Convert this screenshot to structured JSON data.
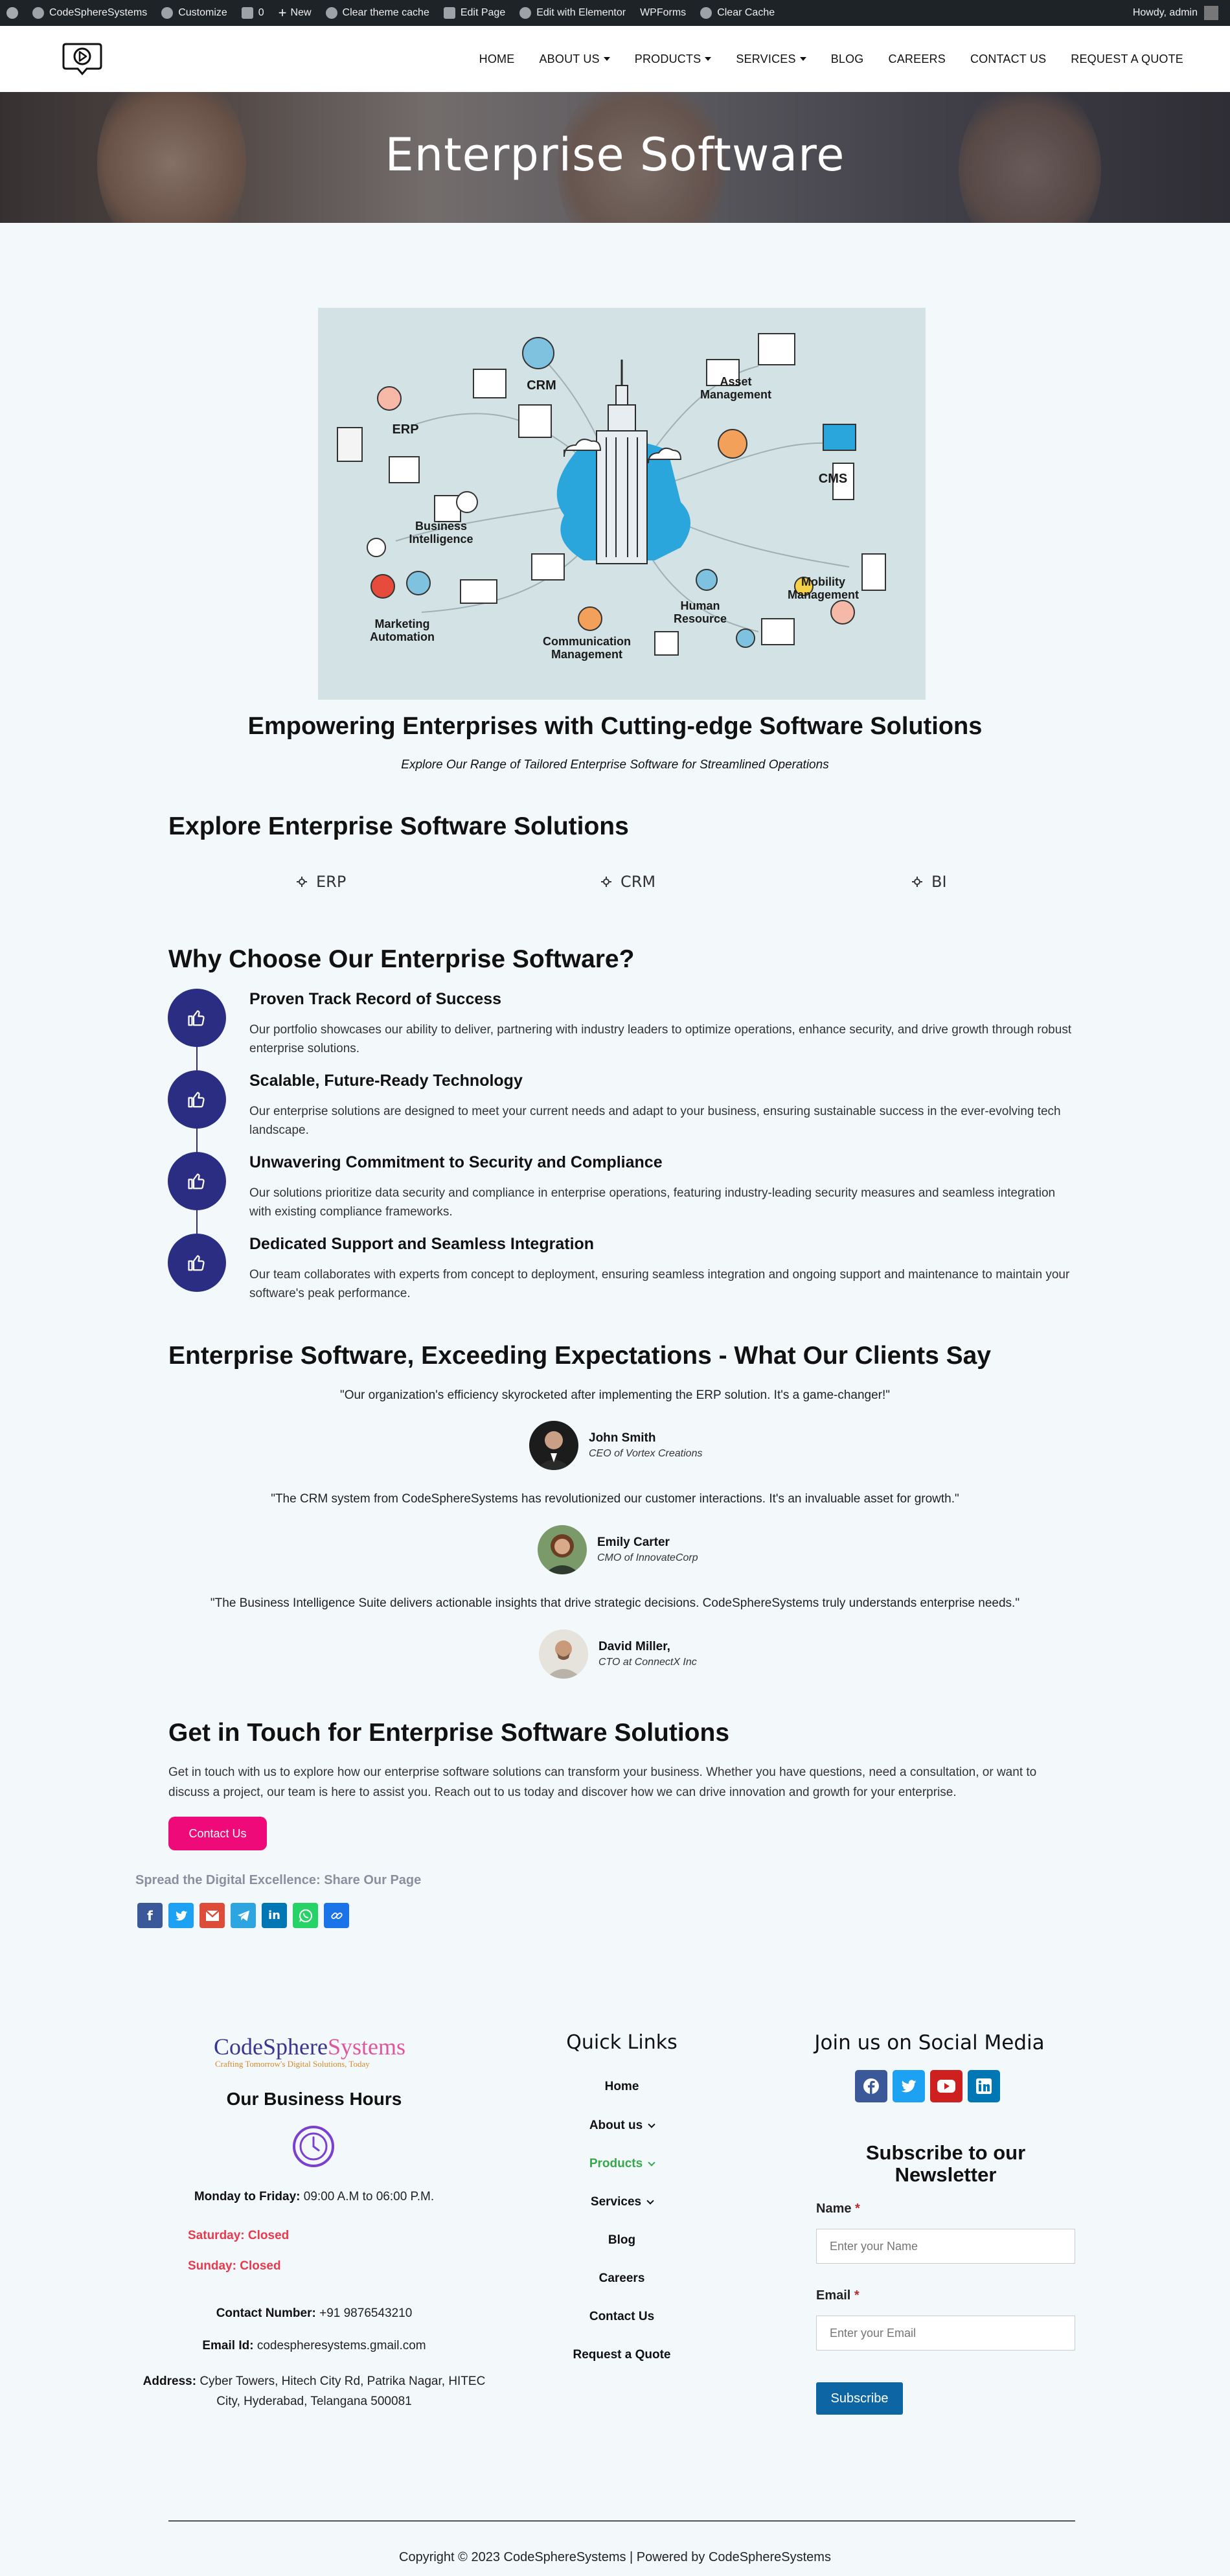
{
  "adminbar": {
    "site_name": "CodeSphereSystems",
    "customize": "Customize",
    "comments_count": "0",
    "new": "New",
    "clear_theme_cache": "Clear theme cache",
    "edit_page": "Edit Page",
    "edit_elementor": "Edit with Elementor",
    "wpforms": "WPForms",
    "clear_cache": "Clear Cache",
    "howdy": "Howdy, admin"
  },
  "nav": {
    "home": "HOME",
    "about": "ABOUT US",
    "products": "PRODUCTS",
    "services": "SERVICES",
    "blog": "BLOG",
    "careers": "CAREERS",
    "contact": "CONTACT US",
    "quote": "REQUEST A QUOTE"
  },
  "hero": {
    "title": "Enterprise Software"
  },
  "illustration": {
    "labels": {
      "crm": "CRM",
      "erp": "ERP",
      "asset": "Asset\nManagement",
      "cms": "CMS",
      "bi": "Business\nIntelligence",
      "mobility": "Mobility\nManagement",
      "marketing": "Marketing\nAutomation",
      "hr": "Human\nResource",
      "comm": "Communication\nManagement"
    }
  },
  "intro": {
    "title": "Empowering Enterprises with Cutting-edge Software Solutions",
    "subtitle": "Explore Our Range of Tailored Enterprise Software for Streamlined Operations"
  },
  "solutions": {
    "title": "Explore Enterprise Software Solutions",
    "items": [
      "ERP",
      "CRM",
      "BI"
    ]
  },
  "why": {
    "title": "Why Choose Our Enterprise Software?",
    "items": [
      {
        "title": "Proven Track Record of Success",
        "text": "Our portfolio showcases our ability to deliver, partnering with industry leaders to optimize operations, enhance security, and drive growth through robust enterprise solutions."
      },
      {
        "title": "Scalable, Future-Ready Technology",
        "text": "Our enterprise solutions are designed to meet your current needs and adapt to your business, ensuring sustainable success in the ever-evolving tech landscape."
      },
      {
        "title": "Unwavering Commitment to Security and Compliance",
        "text": "Our solutions prioritize data security and compliance in enterprise operations, featuring industry-leading security measures and seamless integration with existing compliance frameworks."
      },
      {
        "title": "Dedicated Support and Seamless Integration",
        "text": "Our team collaborates with experts from concept to deployment, ensuring seamless integration and ongoing support and maintenance to maintain your software's peak performance."
      }
    ]
  },
  "testimonials": {
    "title": "Enterprise Software, Exceeding Expectations - What Our Clients Say",
    "items": [
      {
        "quote": "\"Our organization's efficiency skyrocketed after implementing the ERP solution. It's a game-changer!\"",
        "name": "John Smith",
        "role": "CEO of Vortex Creations"
      },
      {
        "quote": "\"The CRM system from CodeSphereSystems has revolutionized our customer interactions. It's an invaluable asset for growth.\"",
        "name": "Emily Carter",
        "role": "CMO of InnovateCorp"
      },
      {
        "quote": "\"The Business Intelligence Suite delivers actionable insights that drive strategic decisions. CodeSphereSystems truly understands enterprise needs.\"",
        "name": "David Miller,",
        "role": "CTO at ConnectX Inc"
      }
    ]
  },
  "contact": {
    "title": "Get in Touch for Enterprise Software Solutions",
    "text": "Get in touch with us to explore how our enterprise software solutions can transform your business. Whether you have questions, need a consultation, or want to discuss a project, our team is here to assist you. Reach out to us today and discover how we can drive innovation and growth for your enterprise.",
    "button": "Contact Us",
    "share_title": "Spread the Digital Excellence: Share Our Page",
    "share_colors": [
      "#3b5998",
      "#1da1f2",
      "#dd4b39",
      "#2ca5e0",
      "#0077b5",
      "#25d366",
      "#1a73e8"
    ]
  },
  "footer": {
    "logo_main": "CodeSphere",
    "logo_accent": "Systems",
    "logo_tagline": "Crafting Tomorrow's Digital Solutions, Today",
    "hours_title": "Our Business Hours",
    "weekday_label": "Monday to Friday:",
    "weekday_value": "09:00 A.M to 06:00 P.M.",
    "saturday": "Saturday: Closed",
    "sunday": "Sunday: Closed",
    "contact_label": "Contact Number:",
    "contact_value": "+91 9876543210",
    "email_label": "Email Id:",
    "email_value": "codespheresystems.gmail.com",
    "address_label": "Address:",
    "address_value": "Cyber Towers, Hitech City Rd, Patrika Nagar, HITEC City, Hyderabad, Telangana 500081",
    "quick_title": "Quick Links",
    "quick": [
      "Home",
      "About us",
      "Products",
      "Services",
      "Blog",
      "Careers",
      "Contact Us",
      "Request a Quote"
    ],
    "social_title": "Join us on Social Media",
    "newsletter_title": "Subscribe to our Newsletter",
    "name_label": "Name",
    "name_placeholder": "Enter your Name",
    "email_label_form": "Email",
    "email_placeholder": "Enter your Email",
    "required_mark": "*",
    "subscribe": "Subscribe",
    "copyright": "Copyright © 2023 CodeSphereSystems | Powered by CodeSphereSystems"
  }
}
